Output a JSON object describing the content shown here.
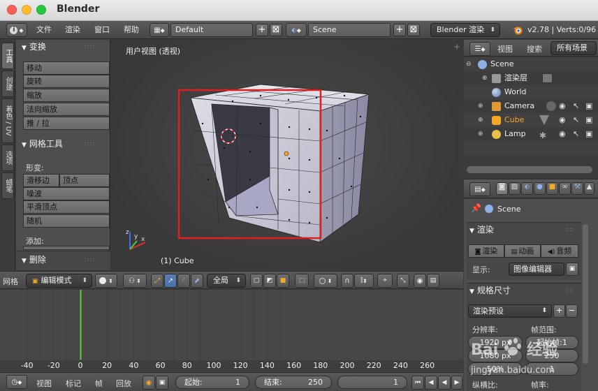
{
  "window": {
    "title": "Blender"
  },
  "info_header": {
    "menus": [
      "文件",
      "渲染",
      "窗口",
      "帮助"
    ],
    "screen_layout": "Default",
    "scene": "Scene",
    "render_engine": "Blender 渲染",
    "version": "v2.78 | Verts:0/96"
  },
  "tool_shelf": {
    "tabs": [
      "工具",
      "创建",
      "着色 / UV",
      "选项",
      "蜡笔"
    ],
    "transform_panel": "变换",
    "transform_buttons": [
      "移动",
      "旋转",
      "缩放",
      "法向缩放",
      "推 / 拉"
    ],
    "mesh_tools_panel": "网格工具",
    "deform_label": "形变:",
    "slide_edge": "滑移边",
    "slide_vertex": "顶点",
    "mesh_buttons": [
      "噪波",
      "平滑顶点",
      "随机"
    ],
    "add_label": "添加:",
    "delete_panel": "删除"
  },
  "viewport": {
    "title": "用户视图 (透视)",
    "object_label": "(1) Cube"
  },
  "viewport_header": {
    "editor_label": "网格",
    "mode": "编辑模式",
    "pivot": "全局"
  },
  "timeline": {
    "ticks": [
      "-40",
      "-20",
      "0",
      "20",
      "40",
      "60",
      "80",
      "100",
      "120",
      "140",
      "160",
      "180",
      "200",
      "220",
      "240",
      "260"
    ],
    "menus": [
      "视图",
      "标记",
      "帧",
      "回放"
    ],
    "start_label": "起始:",
    "start_value": "1",
    "end_label": "结束:",
    "end_value": "250",
    "current_frame": "1"
  },
  "outliner": {
    "tabs": [
      "视图",
      "搜索",
      "所有场景"
    ],
    "items": [
      {
        "label": "Scene",
        "icon": "scene-icon"
      },
      {
        "label": "渲染层",
        "icon": "render-layers-icon"
      },
      {
        "label": "World",
        "icon": "world-icon"
      },
      {
        "label": "Camera",
        "icon": "camera-icon"
      },
      {
        "label": "Cube",
        "icon": "mesh-icon"
      },
      {
        "label": "Lamp",
        "icon": "lamp-icon"
      }
    ]
  },
  "properties": {
    "context": "Scene",
    "render_panel": "渲染",
    "render_buttons": [
      "渲染",
      "动画",
      "音频"
    ],
    "display_label": "显示:",
    "display_value": "图像编辑器",
    "dimensions_panel": "规格尺寸",
    "render_presets": "渲染预设",
    "resolution_label": "分辨率:",
    "frame_range_label": "帧范围:",
    "res_x": "1920 px",
    "start_frame": "起始帧:1",
    "res_y": "1080 px",
    "end_frame": "250",
    "percent": "50%",
    "frame_step": "1",
    "aspect_label": "纵横比:",
    "frame_rate_label": "帧率:"
  },
  "watermark": {
    "line1": "Bai",
    "line2": "经验",
    "url": "jingyan.baidu.com"
  },
  "colors": {
    "selection_box": "#e02020",
    "accent_blue": "#5680c2",
    "timeline_cursor": "#5fce3b",
    "object_orange": "#f5a623"
  }
}
